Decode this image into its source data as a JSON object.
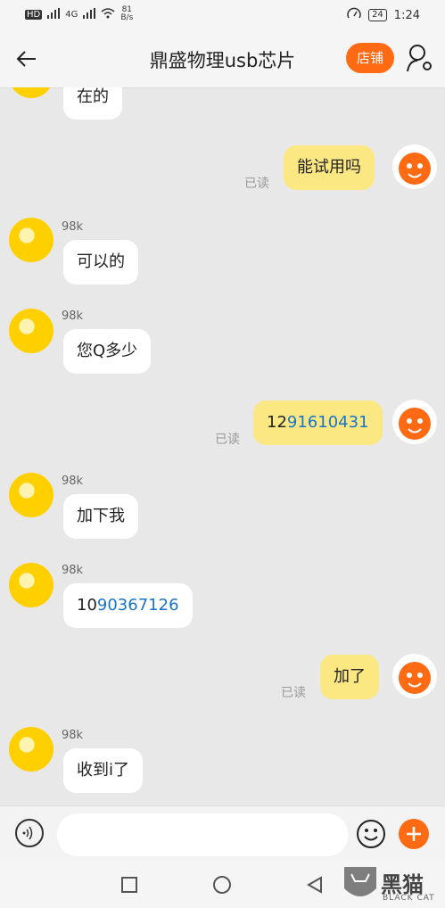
{
  "status_bar": {
    "net_badge": "HD",
    "signal": "4G",
    "speed_value": "81",
    "speed_unit": "B/s",
    "battery": "24",
    "time": "1:24"
  },
  "header": {
    "title": "鼎盛物理usb芯片",
    "shop_label": "店铺"
  },
  "messages": [
    {
      "from": "other",
      "name": "",
      "text": "在的"
    },
    {
      "from": "me",
      "text": "能试用吗",
      "status": "已读"
    },
    {
      "from": "other",
      "name": "98k",
      "text": "可以的"
    },
    {
      "from": "other",
      "name": "98k",
      "text": "您Q多少"
    },
    {
      "from": "me",
      "text_prefix": "12",
      "text_link": "91610431",
      "status": "已读"
    },
    {
      "from": "other",
      "name": "98k",
      "text": "加下我"
    },
    {
      "from": "other",
      "name": "98k",
      "text_prefix": "10",
      "text_link": "90367126"
    },
    {
      "from": "me",
      "text": "加了",
      "status": "已读"
    },
    {
      "from": "other",
      "name": "98k",
      "text": "收到i了"
    }
  ],
  "input": {
    "placeholder": "",
    "value": ""
  },
  "watermark": {
    "main": "黑猫",
    "sub": "BLACK CAT"
  },
  "colors": {
    "accent": "#ff6a13",
    "my_bubble": "#fce883",
    "other_bubble": "#ffffff",
    "link": "#1a73c9"
  }
}
